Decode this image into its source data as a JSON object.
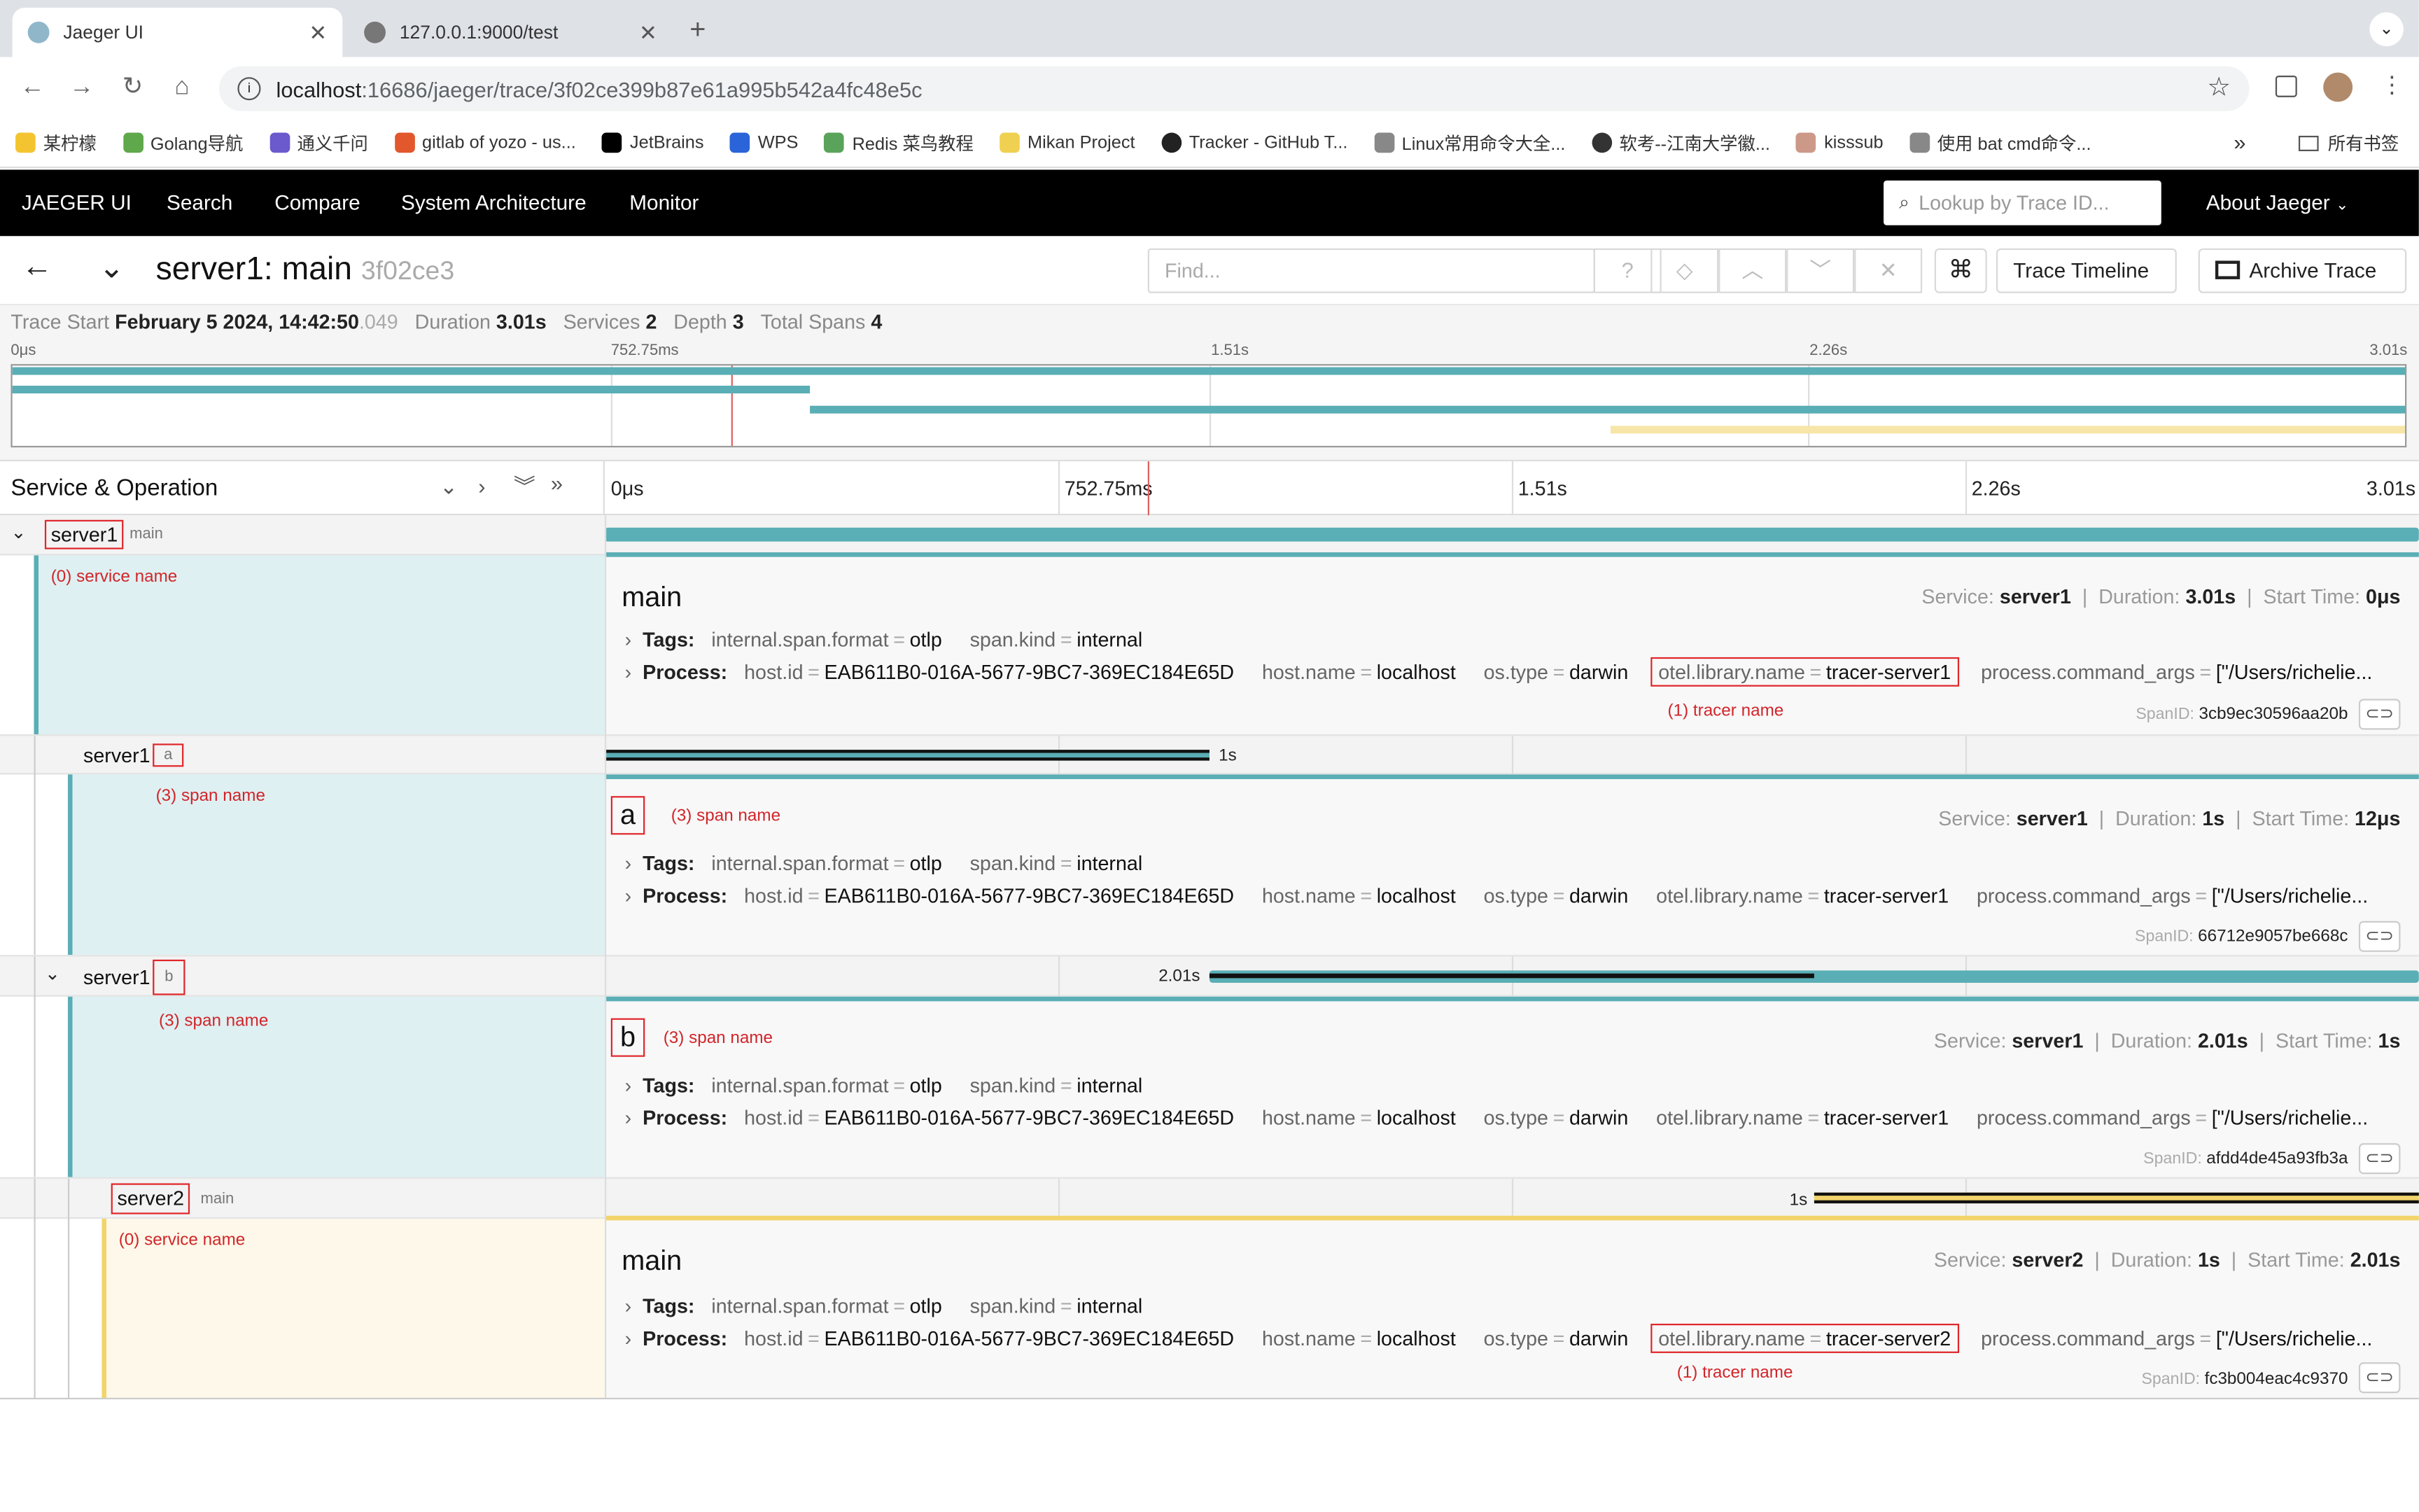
{
  "browser": {
    "tabs": [
      {
        "title": "Jaeger UI",
        "active": true
      },
      {
        "title": "127.0.0.1:9000/test",
        "active": false
      }
    ],
    "url_host": "localhost",
    "url_path": ":16686/jaeger/trace/3f02ce399b87e61a995b542a4fc48e5c",
    "bookmarks": [
      "某柠檬",
      "Golang导航",
      "通义千问",
      "gitlab of yozo - us...",
      "JetBrains",
      "WPS",
      "Redis 菜鸟教程",
      "Mikan Project",
      "Tracker - GitHub T...",
      "Linux常用命令大全...",
      "软考--江南大学徽...",
      "kisssub",
      "使用 bat cmd命令..."
    ],
    "all_bookmarks": "所有书签"
  },
  "jaeger_nav": {
    "brand": "JAEGER UI",
    "items": [
      "Search",
      "Compare",
      "System Architecture",
      "Monitor"
    ],
    "lookup_placeholder": "Lookup by Trace ID...",
    "about": "About Jaeger"
  },
  "trace": {
    "title": "server1: main",
    "trace_id_short": "3f02ce3",
    "find_placeholder": "Find...",
    "view_select": "Trace Timeline",
    "archive": "Archive Trace",
    "summary": {
      "trace_start_label": "Trace Start",
      "trace_start_date": "February 5 2024, 14:42:50",
      "trace_start_ms": ".049",
      "duration_label": "Duration",
      "duration": "3.01s",
      "services_label": "Services",
      "services": "2",
      "depth_label": "Depth",
      "depth": "3",
      "total_spans_label": "Total Spans",
      "total_spans": "4"
    }
  },
  "ticks": [
    "0μs",
    "752.75ms",
    "1.51s",
    "2.26s",
    "3.01s"
  ],
  "column_header": "Service & Operation",
  "colors": {
    "teal": "#5aaeb5",
    "yellow": "#f7e6a8",
    "annotation": "#d1252a",
    "teal_bg": "#dff0f2",
    "yellow_bg": "#fdf8e9"
  },
  "tag_labels": {
    "tags": "Tags:",
    "process": "Process:",
    "service": "Service:",
    "duration": "Duration:",
    "start_time": "Start Time:",
    "spanid": "SpanID:"
  },
  "spans": [
    {
      "service": "server1",
      "operation": "main",
      "name_annotation": "(0) service name",
      "detail_title": "main",
      "detail_service": "server1",
      "detail_duration": "3.01s",
      "detail_start": "0μs",
      "tags": [
        [
          "internal.span.format",
          "otlp"
        ],
        [
          "span.kind",
          "internal"
        ]
      ],
      "process": [
        [
          "host.id",
          "EAB611B0-016A-5677-9BC7-369EC184E65D"
        ],
        [
          "host.name",
          "localhost"
        ],
        [
          "os.type",
          "darwin"
        ],
        [
          "otel.library.name",
          "tracer-server1"
        ],
        [
          "process.command_args",
          "[\"/Users/richelie..."
        ]
      ],
      "tracer_annotation": "(1) tracer name",
      "span_id": "3cb9ec30596aa20b"
    },
    {
      "service": "server1",
      "operation": "a",
      "name_annotation": "(3) span name",
      "bar_label": "1s",
      "detail_title": "a",
      "detail_annotation": "(3) span name",
      "detail_service": "server1",
      "detail_duration": "1s",
      "detail_start": "12μs",
      "tags": [
        [
          "internal.span.format",
          "otlp"
        ],
        [
          "span.kind",
          "internal"
        ]
      ],
      "process": [
        [
          "host.id",
          "EAB611B0-016A-5677-9BC7-369EC184E65D"
        ],
        [
          "host.name",
          "localhost"
        ],
        [
          "os.type",
          "darwin"
        ],
        [
          "otel.library.name",
          "tracer-server1"
        ],
        [
          "process.command_args",
          "[\"/Users/richelie..."
        ]
      ],
      "span_id": "66712e9057be668c"
    },
    {
      "service": "server1",
      "operation": "b",
      "name_annotation": "(3) span name",
      "bar_label": "2.01s",
      "detail_title": "b",
      "detail_annotation": "(3) span name",
      "detail_service": "server1",
      "detail_duration": "2.01s",
      "detail_start": "1s",
      "tags": [
        [
          "internal.span.format",
          "otlp"
        ],
        [
          "span.kind",
          "internal"
        ]
      ],
      "process": [
        [
          "host.id",
          "EAB611B0-016A-5677-9BC7-369EC184E65D"
        ],
        [
          "host.name",
          "localhost"
        ],
        [
          "os.type",
          "darwin"
        ],
        [
          "otel.library.name",
          "tracer-server1"
        ],
        [
          "process.command_args",
          "[\"/Users/richelie..."
        ]
      ],
      "span_id": "afdd4de45a93fb3a"
    },
    {
      "service": "server2",
      "operation": "main",
      "name_annotation": "(0) service name",
      "bar_label": "1s",
      "detail_title": "main",
      "detail_service": "server2",
      "detail_duration": "1s",
      "detail_start": "2.01s",
      "tags": [
        [
          "internal.span.format",
          "otlp"
        ],
        [
          "span.kind",
          "internal"
        ]
      ],
      "process": [
        [
          "host.id",
          "EAB611B0-016A-5677-9BC7-369EC184E65D"
        ],
        [
          "host.name",
          "localhost"
        ],
        [
          "os.type",
          "darwin"
        ],
        [
          "otel.library.name",
          "tracer-server2"
        ],
        [
          "process.command_args",
          "[\"/Users/richelie..."
        ]
      ],
      "tracer_annotation": "(1) tracer name",
      "span_id": "fc3b004eac4c9370"
    }
  ]
}
